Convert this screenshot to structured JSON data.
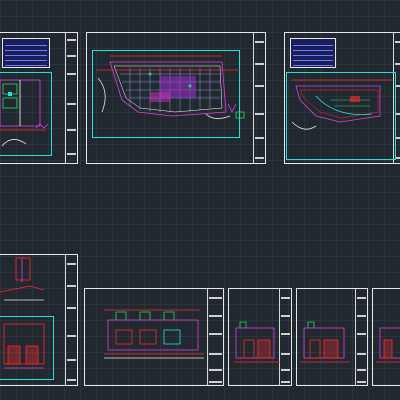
{
  "app": {
    "window_title": "",
    "drawing_area": "model-space"
  },
  "colors": {
    "background": "#212830",
    "grid": "#2b333d",
    "sheet_border": "#e8e8e8",
    "viewport": "#27e0d8",
    "wall_magenta": "#e040e0",
    "dimension_red": "#ff2a2a",
    "plan_green": "#20e060",
    "legend_fill": "#1a1f5a",
    "legend_line": "#6d7cff"
  },
  "sheets": [
    {
      "id": "sheet-1",
      "kind": "plan-with-legend"
    },
    {
      "id": "sheet-2",
      "kind": "floor-plan"
    },
    {
      "id": "sheet-3",
      "kind": "plan-with-legend"
    },
    {
      "id": "sheet-4",
      "kind": "detail"
    },
    {
      "id": "sheet-5",
      "kind": "elevation"
    },
    {
      "id": "sheet-6",
      "kind": "elevation"
    },
    {
      "id": "sheet-7",
      "kind": "elevation"
    },
    {
      "id": "sheet-8",
      "kind": "elevation"
    }
  ]
}
